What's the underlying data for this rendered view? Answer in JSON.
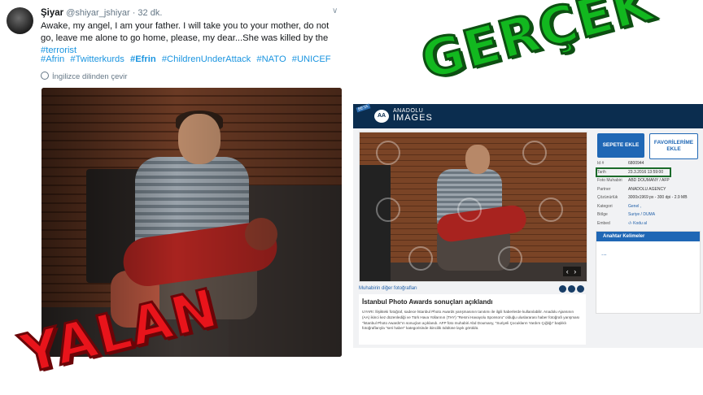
{
  "tweet": {
    "display_name": "Şiyar",
    "handle": "@shiyar_jshiyar",
    "time": "· 32 dk.",
    "text_main": "Awake, my angel, I am your father. I will take you to your mother, do not go, leave me alone to go home, please, my dear...She was killed by the ",
    "text_hashtag": "#terrorist",
    "hashtags": [
      "#Afrin",
      "#Twitterkurds",
      "#Efrin",
      "#ChildrenUnderAttack",
      "#NATO",
      "#UNICEF"
    ],
    "translate": "İngilizce dilinden çevir"
  },
  "aa": {
    "beta": "BETA",
    "logo": "AA",
    "brand_top": "ANADOLU",
    "brand_bottom": "IMAGES",
    "add_cart": "SEPETE EKLE",
    "add_fav": "FAVORİLERİME EKLE",
    "meta": [
      {
        "k": "Id #",
        "v": "6800944"
      },
      {
        "k": "Tarih",
        "v": "23.3.2016 13:59:00"
      },
      {
        "k": "Foto Muhabiri",
        "v": "ABD DOUMANY / AFP"
      },
      {
        "k": "Partner",
        "v": "ANADOLU AGENCY"
      },
      {
        "k": "Çözünürlük",
        "v": "3000x1969 px - 300 dpi - 2.9 MB"
      },
      {
        "k": "Kategori",
        "v": "Genel ,"
      },
      {
        "k": "Bölge",
        "v": "Suriye / DUMA"
      },
      {
        "k": "Embed",
        "v": "‹/› Kodu al"
      }
    ],
    "keywords_title": "Anahtar Kelimeler",
    "keywords_more": "...",
    "photographer_link": "Muhabirin diğer fotoğrafları",
    "news_title": "İstanbul Photo Awards sonuçları açıklandı",
    "news_body": "UYARI: İlişikteki fotoğraf, sadece İstanbul Photo Awards yarışmasının tanıtımı ile ilgili haberlerde kullanılabilir. Anadolu Ajansının (AA) ikinci kez düzenlediği ve Türk Hava Yollarının (THY) \"Resmi Havayolu Sponsoru\" olduğu uluslararası haber fotoğrafı yarışması \"İstanbul Photo Awards\"ın sonuçları açıklandı. AFP foto muhabiri Abd Doumany, \"Suriyeli Çocukların Yardım Çığlığı\" başlıklı fotoğraflarıyla \"seri haber\" kategorisinde ikincilik ödülüne layık görüldü.",
    "arrows": "‹ ›"
  },
  "labels": {
    "real": "GERÇEK",
    "fake": "YALAN"
  }
}
